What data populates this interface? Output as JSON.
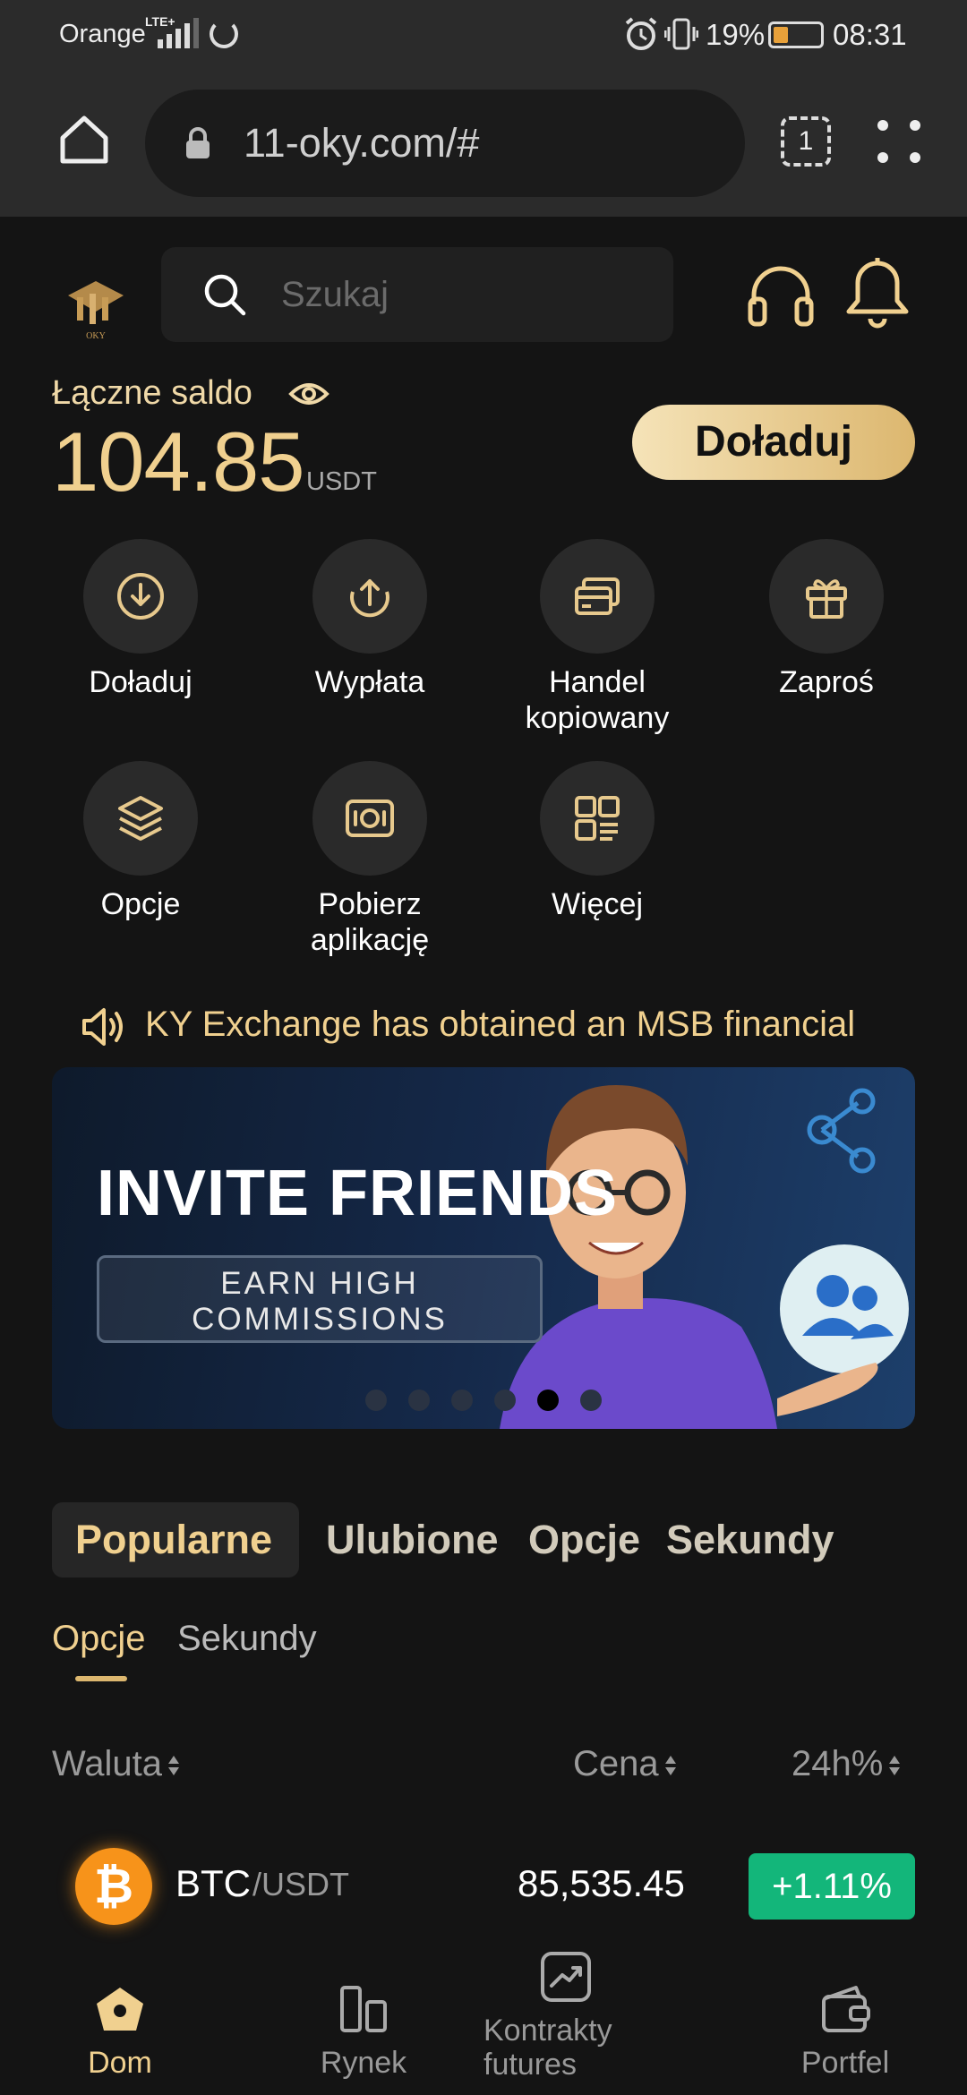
{
  "status_bar": {
    "carrier": "Orange",
    "network": "LTE+",
    "battery_percent": "19%",
    "time": "08:31"
  },
  "browser": {
    "url": "11-oky.com/#",
    "tab_count": "1"
  },
  "header": {
    "logo_text": "OKY",
    "search_placeholder": "Szukaj"
  },
  "balance": {
    "label": "Łączne saldo",
    "value": "104.85",
    "unit": "USDT",
    "topup_label": "Doładuj"
  },
  "actions": [
    {
      "label": "Doładuj",
      "icon": "deposit-icon"
    },
    {
      "label": "Wypłata",
      "icon": "withdraw-icon"
    },
    {
      "label": "Handel kopiowany",
      "icon": "copy-trade-icon"
    },
    {
      "label": "Zaproś",
      "icon": "gift-icon"
    },
    {
      "label": "Opcje",
      "icon": "layers-icon"
    },
    {
      "label": "Pobierz aplikację",
      "icon": "download-app-icon"
    },
    {
      "label": "Więcej",
      "icon": "more-grid-icon"
    }
  ],
  "announcement": "KY Exchange has obtained an MSB financial",
  "banner": {
    "title": "INVITE FRIENDS",
    "subtitle_line1": "EARN HIGH",
    "subtitle_line2": "COMMISSIONS",
    "slide_count": 6,
    "active_slide": 5
  },
  "tabs": {
    "main": [
      "Popularne",
      "Ulubione",
      "Opcje",
      "Sekundy"
    ],
    "main_active": "Popularne",
    "sub": [
      "Opcje",
      "Sekundy"
    ],
    "sub_active": "Opcje"
  },
  "table": {
    "headers": {
      "currency": "Waluta",
      "price": "Cena",
      "change": "24h%"
    },
    "rows": [
      {
        "base": "BTC",
        "quote": "/USDT",
        "price": "85,535.45",
        "change": "+1.11%"
      }
    ]
  },
  "bottom_nav": [
    {
      "label": "Dom",
      "icon": "home-icon",
      "active": true
    },
    {
      "label": "Rynek",
      "icon": "market-icon",
      "active": false
    },
    {
      "label": "Kontrakty futures",
      "icon": "futures-icon",
      "active": false
    },
    {
      "label": "Portfel",
      "icon": "wallet-icon",
      "active": false
    }
  ],
  "colors": {
    "accent": "#F0D08F",
    "background": "#141414",
    "positive": "#13B67A"
  }
}
